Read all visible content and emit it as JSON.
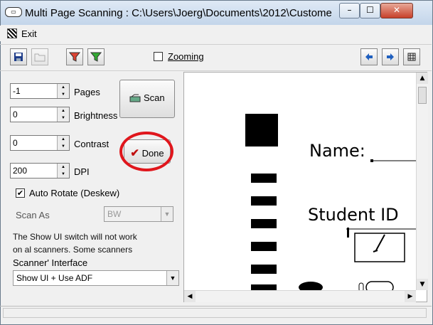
{
  "window": {
    "app_icon": "scanner-app-icon",
    "title": "Multi Page Scanning  :  C:\\Users\\Joerg\\Documents\\2012\\Custome",
    "controls": {
      "minimize": "–",
      "maximize": "☐",
      "close": "✕"
    }
  },
  "menu": {
    "exit_label": "Exit"
  },
  "toolbar": {
    "zoom_label": "Zooming",
    "zoom_checked": false,
    "icons": [
      "save-icon",
      "open-folder-icon",
      "filter-red-icon",
      "filter-green-icon",
      "arrow-left-icon",
      "arrow-right-icon",
      "grid-icon"
    ]
  },
  "settings": {
    "pages_value": "-1",
    "pages_label": "Pages",
    "brightness_value": "0",
    "brightness_label": "Brightness",
    "contrast_value": "0",
    "contrast_label": "Contrast",
    "dpi_value": "200",
    "dpi_label": "DPI",
    "scan_label": "Scan",
    "done_label": "Done",
    "auto_rotate_label": "Auto Rotate (Deskew)",
    "auto_rotate_checked": true,
    "scan_as_label": "Scan As",
    "scan_as_value": "BW",
    "note_line1": "The Show UI switch will not work",
    "note_line2": "on al scanners. Some scanners",
    "interface_label": "Scanner' Interface",
    "interface_value": "Show UI + Use ADF"
  },
  "document": {
    "name_label": "Name:",
    "student_id_label": "Student ID"
  },
  "colors": {
    "highlight_circle": "#e0161c",
    "done_check": "#c01010"
  }
}
